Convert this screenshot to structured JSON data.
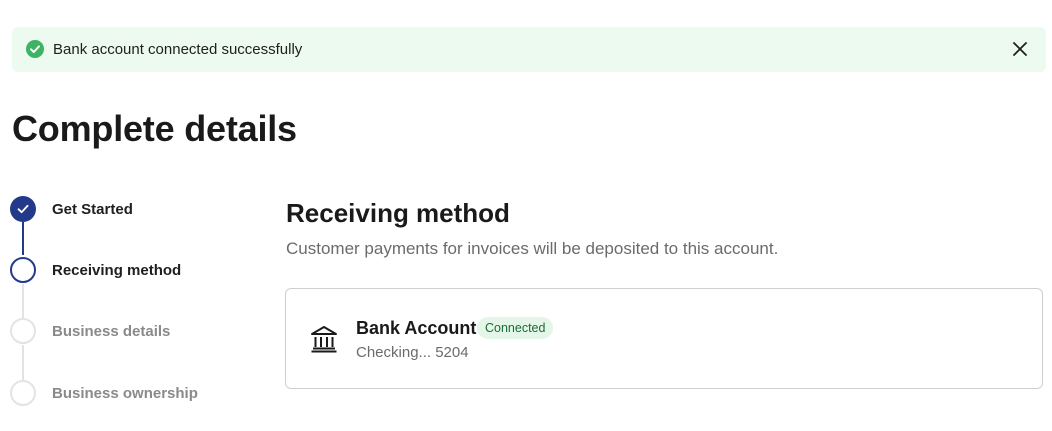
{
  "toast": {
    "message": "Bank account connected successfully",
    "status_icon": "check-circle-icon",
    "close_icon": "close-icon",
    "accent_color": "#3cb464",
    "background_color": "#ecfaef"
  },
  "page": {
    "title": "Complete details"
  },
  "stepper": {
    "steps": [
      {
        "label": "Get Started",
        "state": "completed"
      },
      {
        "label": "Receiving method",
        "state": "current"
      },
      {
        "label": "Business details",
        "state": "upcoming"
      },
      {
        "label": "Business ownership",
        "state": "upcoming"
      }
    ],
    "active_color": "#233a8a",
    "inactive_color": "#e3e3e3"
  },
  "section": {
    "title": "Receiving method",
    "subtitle": "Customer payments for invoices will be deposited to this account."
  },
  "account_card": {
    "icon": "bank-icon",
    "name": "Bank Account",
    "status": "Connected",
    "detail": "Checking... 5204"
  }
}
